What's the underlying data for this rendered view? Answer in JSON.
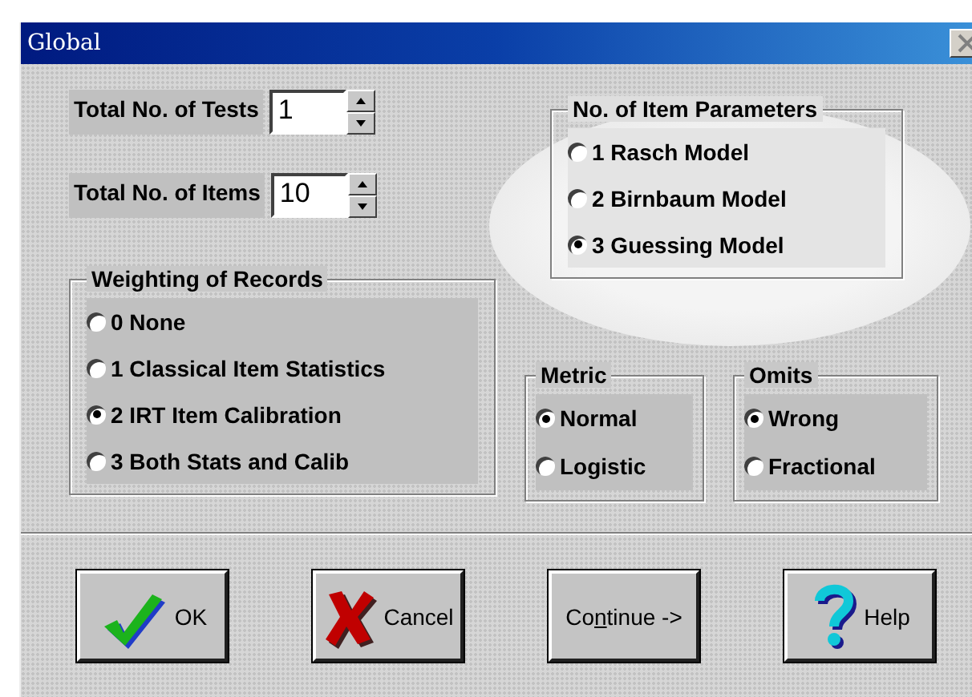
{
  "window": {
    "title": "Global"
  },
  "spin_fields": [
    {
      "label": "Total No. of Tests",
      "value": "1"
    },
    {
      "label": "Total No. of Items",
      "value": "10"
    }
  ],
  "weighting": {
    "title": "Weighting of Records",
    "options": [
      {
        "label": "0 None",
        "selected": false
      },
      {
        "label": "1 Classical Item Statistics",
        "selected": false
      },
      {
        "label": "2 IRT Item Calibration",
        "selected": true
      },
      {
        "label": "3 Both Stats and Calib",
        "selected": false
      }
    ]
  },
  "item_parameters": {
    "title": "No. of Item Parameters",
    "options": [
      {
        "label": "1 Rasch Model",
        "selected": false
      },
      {
        "label": "2 Birnbaum Model",
        "selected": false
      },
      {
        "label": "3 Guessing Model",
        "selected": true
      }
    ]
  },
  "metric": {
    "title": "Metric",
    "options": [
      {
        "label": "Normal",
        "selected": true
      },
      {
        "label": "Logistic",
        "selected": false
      }
    ]
  },
  "omits": {
    "title": "Omits",
    "options": [
      {
        "label": "Wrong",
        "selected": true
      },
      {
        "label": "Fractional",
        "selected": false
      }
    ]
  },
  "buttons": [
    {
      "kind": "check",
      "label_parts": [
        {
          "text": "OK",
          "underlined": false
        }
      ]
    },
    {
      "kind": "cross",
      "label_parts": [
        {
          "text": "Cancel",
          "underlined": false
        }
      ]
    },
    {
      "kind": "plain",
      "label_parts": [
        {
          "text": "Co",
          "underlined": false
        },
        {
          "text": "n",
          "underlined": true
        },
        {
          "text": "tinue ->",
          "underlined": false
        }
      ]
    },
    {
      "kind": "help",
      "label_parts": [
        {
          "text": "Help",
          "underlined": false
        }
      ]
    }
  ]
}
